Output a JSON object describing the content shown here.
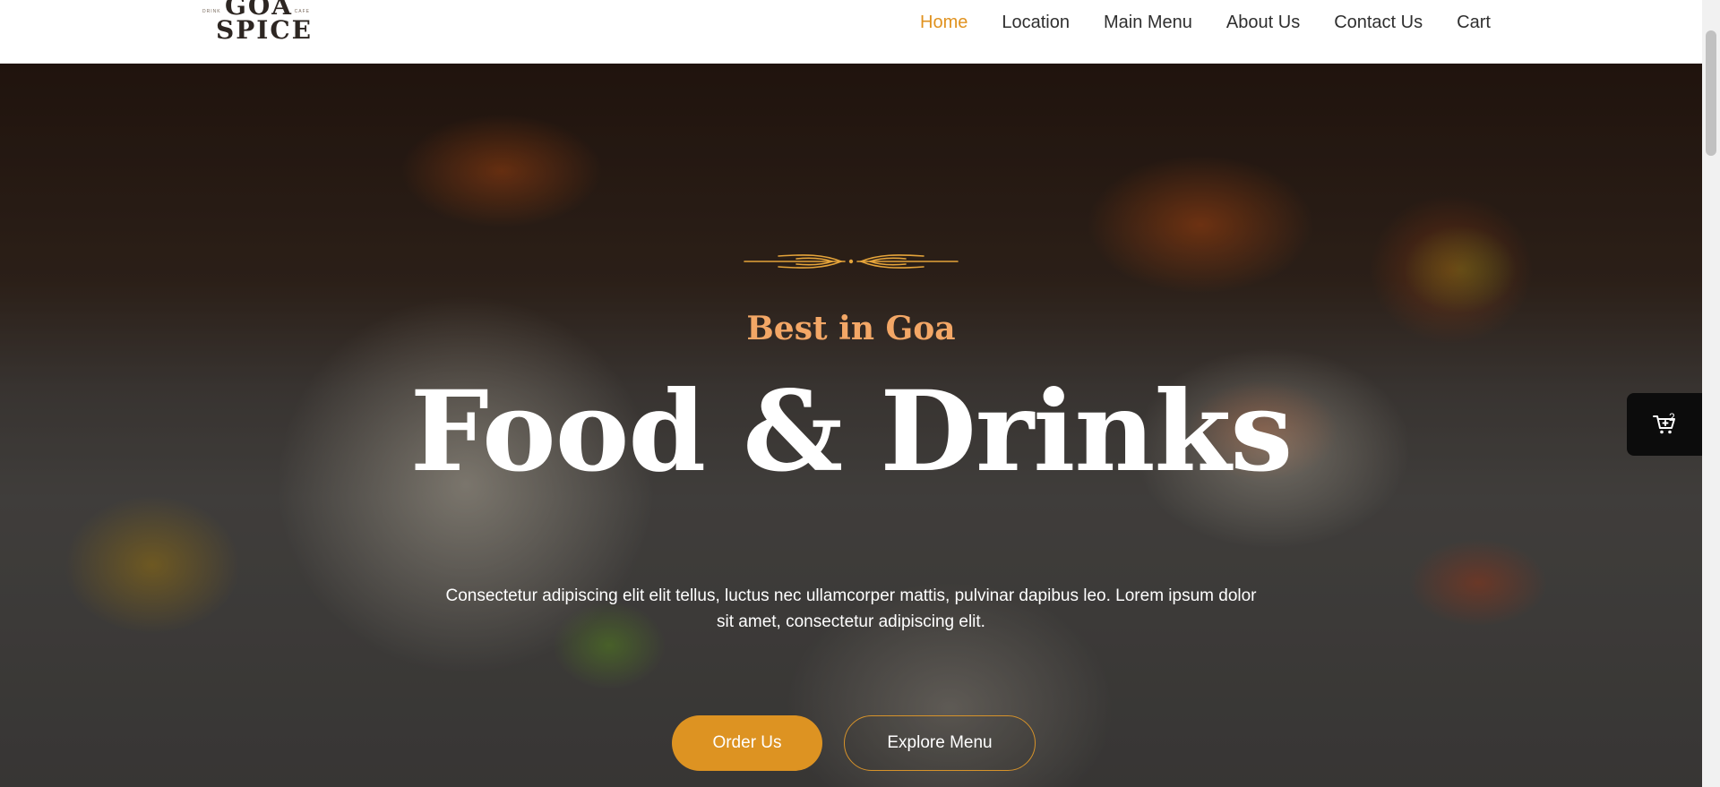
{
  "header": {
    "logo": {
      "line1": "GOA",
      "line2": "SPICE",
      "left_small": "DRINK",
      "right_small": "CAFE"
    },
    "nav": [
      {
        "label": "Home",
        "active": true
      },
      {
        "label": "Location",
        "active": false
      },
      {
        "label": "Main Menu",
        "active": false
      },
      {
        "label": "About Us",
        "active": false
      },
      {
        "label": "Contact Us",
        "active": false
      },
      {
        "label": "Cart",
        "active": false
      }
    ]
  },
  "hero": {
    "tagline": "Best in Goa",
    "headline": "Food & Drinks",
    "description": "Consectetur adipiscing elit elit tellus, luctus nec ullamcorper mattis, pulvinar dapibus leo. Lorem ipsum dolor sit amet, consectetur adipiscing elit.",
    "primary_button": "Order Us",
    "secondary_button": "Explore Menu"
  },
  "cart_widget": {
    "icon": "cart-icon",
    "count": "2"
  },
  "colors": {
    "accent": "#dd9322",
    "nav_active": "#e0921f",
    "tagline": "#f3a766",
    "text_dark": "#2f2f2f"
  }
}
